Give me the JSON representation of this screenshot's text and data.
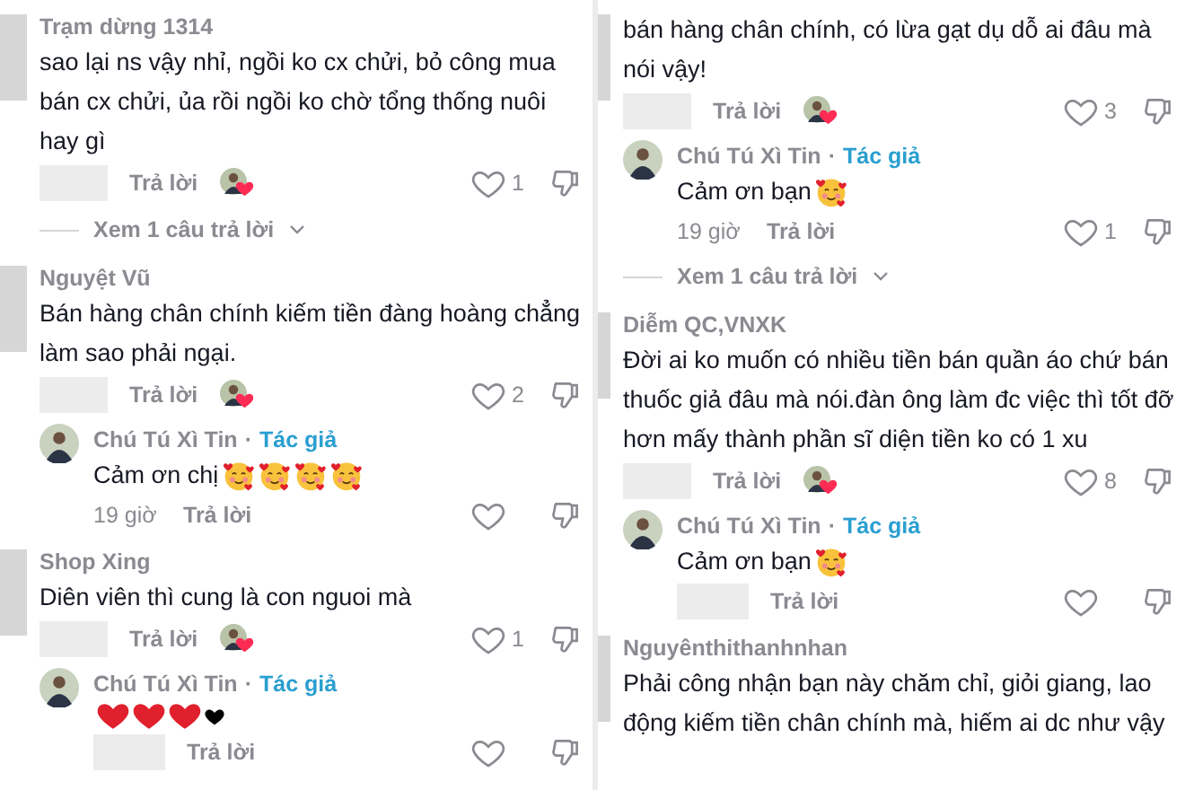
{
  "panels": [
    {
      "items": [
        {
          "kind": "comment",
          "author": "Trạm dừng 1314",
          "text": "sao lại ns vậy nhỉ, ngồi ko cx chửi, bỏ công mua bán cx chửi, ủa rồi ngồi ko chờ tổng thống nuôi hay gì",
          "actions": {
            "reply": "Trả lời",
            "creator_liked": true,
            "likes": "1"
          }
        },
        {
          "kind": "more",
          "text": "Xem 1 câu trả lời"
        },
        {
          "kind": "comment",
          "author": "Nguyệt Vũ",
          "text": "Bán hàng chân chính kiếm tiền đàng hoàng chẳng làm sao phải ngại.",
          "actions": {
            "reply": "Trả lời",
            "creator_liked": true,
            "likes": "2"
          }
        },
        {
          "kind": "reply",
          "author": "Chú Tú Xì Tin",
          "separator": "·",
          "badge": "Tác giả",
          "text": "Cảm ơn chị",
          "emojis": [
            {
              "kind": "hearts_face"
            },
            {
              "kind": "hearts_face"
            },
            {
              "kind": "hearts_face"
            },
            {
              "kind": "hearts_face"
            }
          ],
          "actions": {
            "time": "19 giờ",
            "reply": "Trả lời"
          }
        },
        {
          "kind": "comment",
          "author": "Shop Xing",
          "text": "Diên viên thì cung là con nguoi mà",
          "actions": {
            "reply": "Trả lời",
            "creator_liked": true,
            "likes": "1"
          }
        },
        {
          "kind": "reply",
          "author": "Chú Tú Xì Tin",
          "separator": "·",
          "badge": "Tác giả",
          "emojis": [
            {
              "kind": "heart",
              "color": "#e0202c"
            },
            {
              "kind": "heart",
              "color": "#e0202c"
            },
            {
              "kind": "heart",
              "color": "#e0202c"
            },
            {
              "kind": "small_heart",
              "color": "#000000"
            }
          ],
          "actions": {
            "reply": "Trả lời"
          }
        }
      ]
    },
    {
      "items": [
        {
          "kind": "comment",
          "text": "bán hàng chân chính, có lừa gạt dụ dỗ ai đâu mà nói vậy!",
          "actions": {
            "reply": "Trả lời",
            "creator_liked": true,
            "likes": "3"
          }
        },
        {
          "kind": "reply",
          "author": "Chú Tú Xì Tin",
          "separator": "·",
          "badge": "Tác giả",
          "text": "Cảm ơn bạn",
          "emojis": [
            {
              "kind": "hearts_face"
            }
          ],
          "actions": {
            "time": "19 giờ",
            "reply": "Trả lời",
            "likes": "1"
          }
        },
        {
          "kind": "more",
          "text": "Xem 1 câu trả lời"
        },
        {
          "kind": "comment",
          "author": "Diễm QC,VNXK",
          "text": "Đời ai ko muốn có nhiều tiền bán quần áo chứ bán thuốc giả đâu mà nói.đàn ông làm đc việc thì tốt đỡ hơn mấy thành phần sĩ diện tiền ko có 1 xu",
          "actions": {
            "reply": "Trả lời",
            "creator_liked": true,
            "likes": "8"
          }
        },
        {
          "kind": "reply",
          "author": "Chú Tú Xì Tin",
          "separator": "·",
          "badge": "Tác giả",
          "text": "Cảm ơn bạn",
          "emojis": [
            {
              "kind": "hearts_face"
            }
          ],
          "actions": {
            "reply": "Trả lời"
          }
        },
        {
          "kind": "comment",
          "author": "Nguyênthithanhnhan",
          "text": "Phải công nhận bạn này chăm chỉ, giỏi giang, lao động kiếm tiền chân chính mà, hiếm ai dc như vậy"
        }
      ]
    }
  ]
}
